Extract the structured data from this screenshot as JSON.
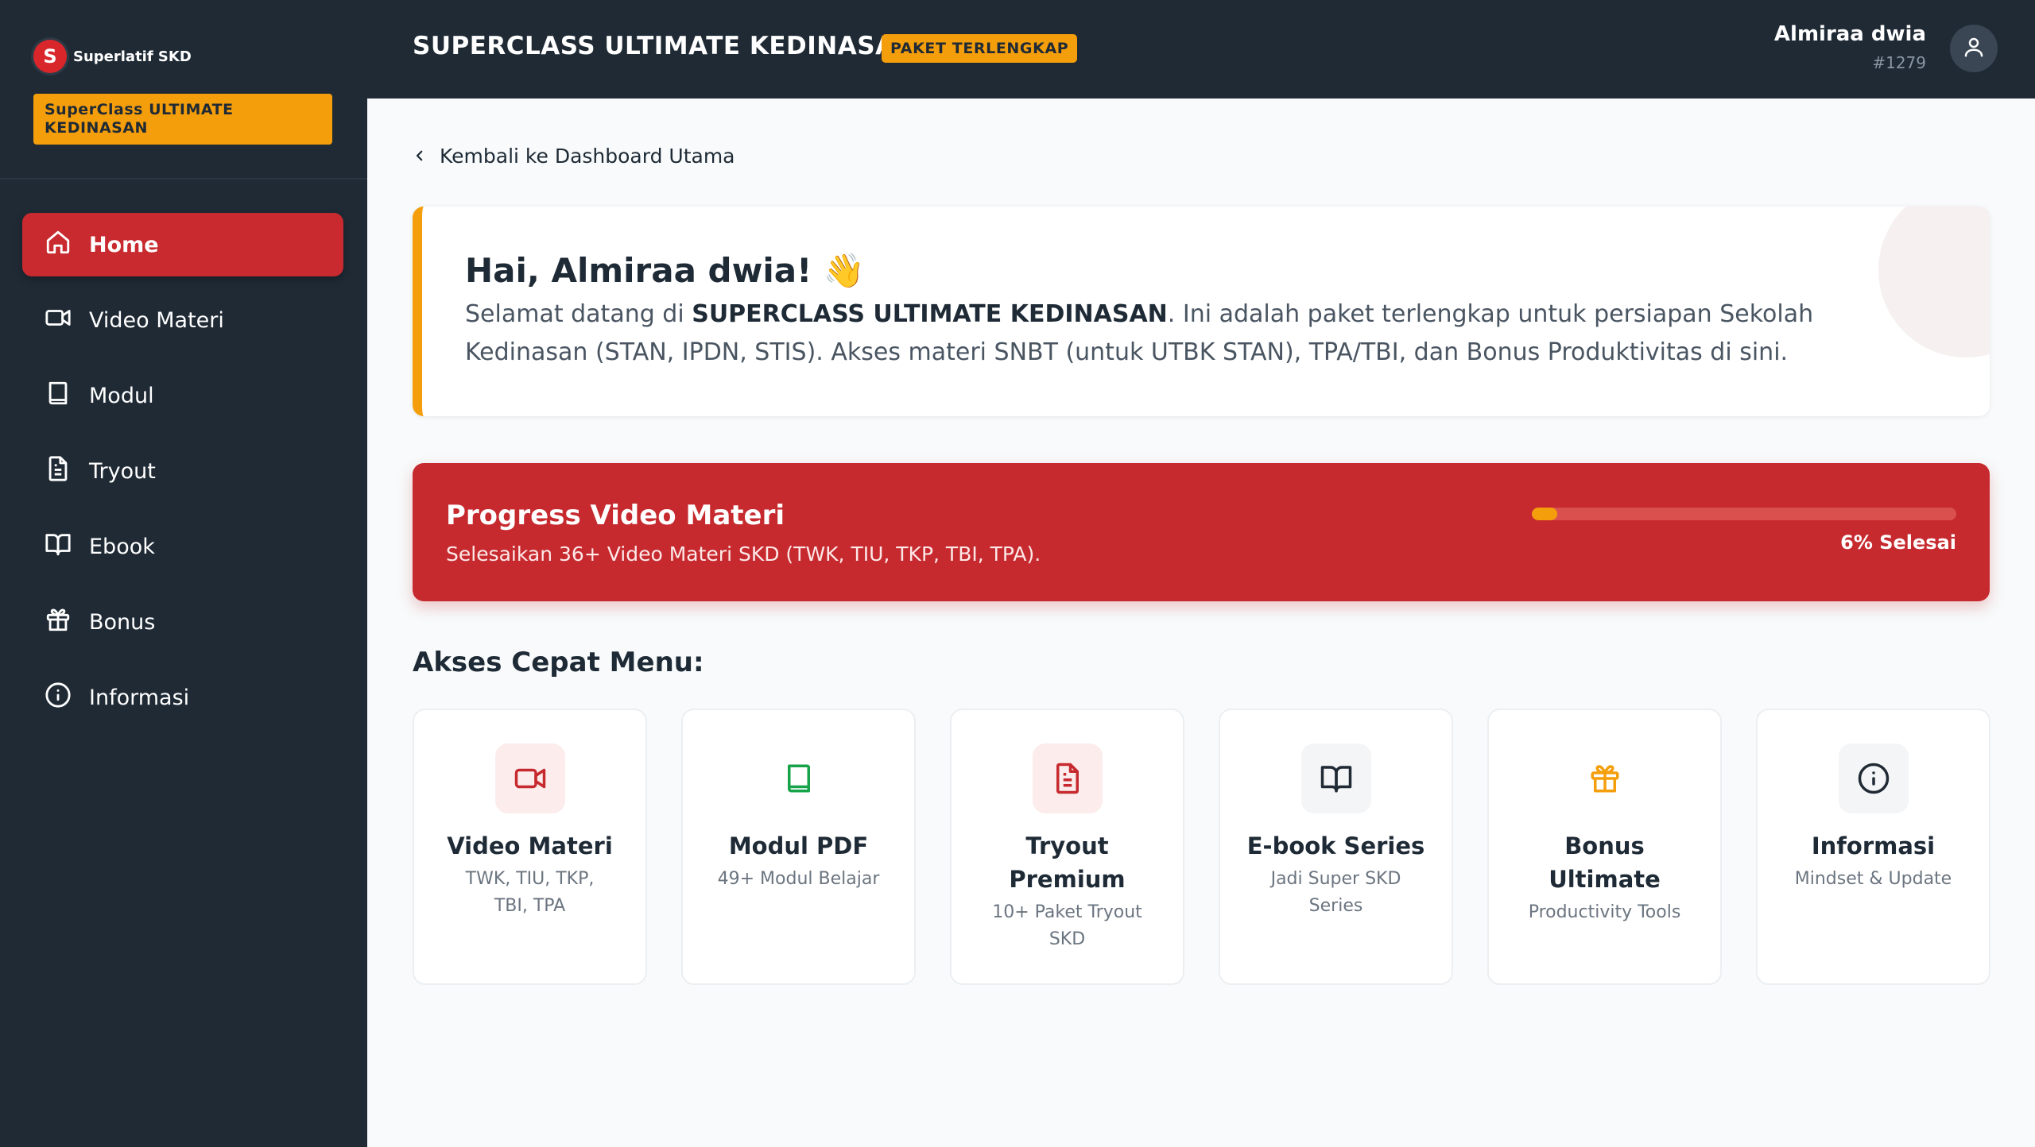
{
  "brand": {
    "logo_letter": "S",
    "name": "Superlatif SKD"
  },
  "sidebar": {
    "package_badge": "SuperClass ULTIMATE KEDINASAN",
    "items": [
      {
        "label": "Home",
        "icon": "home-icon",
        "active": true
      },
      {
        "label": "Video Materi",
        "icon": "video-icon",
        "active": false
      },
      {
        "label": "Modul",
        "icon": "book-icon",
        "active": false
      },
      {
        "label": "Tryout",
        "icon": "document-icon",
        "active": false
      },
      {
        "label": "Ebook",
        "icon": "open-book-icon",
        "active": false
      },
      {
        "label": "Bonus",
        "icon": "gift-icon",
        "active": false
      },
      {
        "label": "Informasi",
        "icon": "info-icon",
        "active": false
      }
    ]
  },
  "header": {
    "title": "SUPERCLASS ULTIMATE KEDINASAN",
    "badge": "PAKET TERLENGKAP",
    "user_name": "Almiraa dwia",
    "user_id": "#1279"
  },
  "main": {
    "back_link": "Kembali ke Dashboard Utama",
    "welcome": {
      "title": "Hai, Almiraa dwia! 👋",
      "text_prefix": "Selamat datang di ",
      "text_bold": "SUPERCLASS ULTIMATE KEDINASAN",
      "text_suffix": ". Ini adalah paket terlengkap untuk persiapan Sekolah Kedinasan (STAN, IPDN, STIS). Akses materi SNBT (untuk UTBK STAN), TPA/TBI, dan Bonus Produktivitas di sini."
    },
    "progress": {
      "title": "Progress Video Materi",
      "subtitle": "Selesaikan 36+ Video Materi SKD (TWK, TIU, TKP, TBI, TPA).",
      "percent": 6,
      "label": "6% Selesai"
    },
    "quick_title": "Akses Cepat Menu:",
    "cards": [
      {
        "title": "Video Materi",
        "subtitle": "TWK, TIU, TKP, TBI, TPA",
        "icon": "video-icon",
        "color": "#c62a2f",
        "bg": "#fcecec"
      },
      {
        "title": "Modul PDF",
        "subtitle": "49+ Modul Belajar",
        "icon": "book-icon",
        "color": "#16a34a",
        "bg": "#ffffff"
      },
      {
        "title": "Tryout Premium",
        "subtitle": "10+ Paket Tryout SKD",
        "icon": "document-icon",
        "color": "#c62a2f",
        "bg": "#fcecec"
      },
      {
        "title": "E-book Series",
        "subtitle": "Jadi Super SKD Series",
        "icon": "open-book-icon",
        "color": "#1f2a35",
        "bg": "#f4f5f6"
      },
      {
        "title": "Bonus Ultimate",
        "subtitle": "Productivity Tools",
        "icon": "gift-icon",
        "color": "#f59e0b",
        "bg": "#ffffff"
      },
      {
        "title": "Informasi",
        "subtitle": "Mindset & Update",
        "icon": "info-icon",
        "color": "#1f2a35",
        "bg": "#f4f5f6"
      }
    ]
  }
}
